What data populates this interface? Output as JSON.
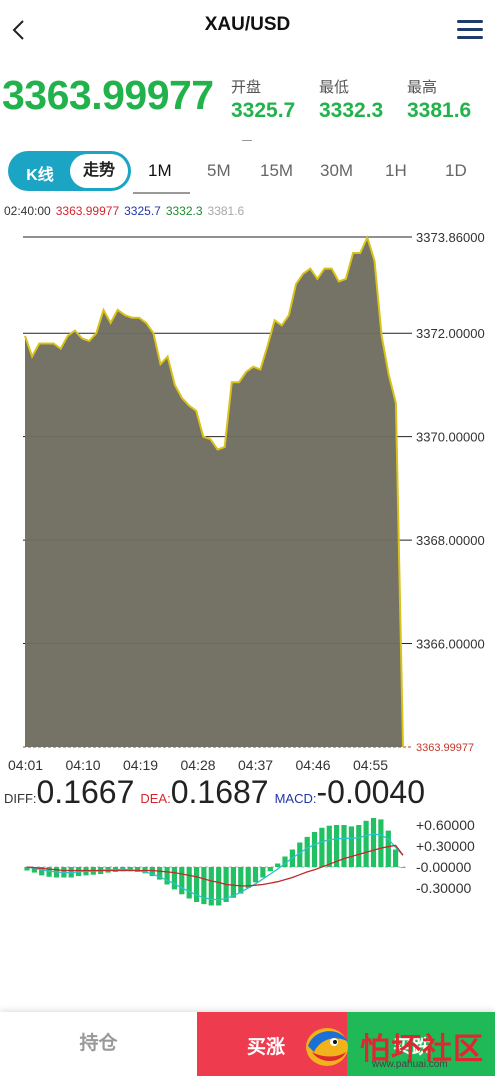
{
  "header": {
    "title": "XAU/USD"
  },
  "quote": {
    "price": "3363.99977",
    "stats": [
      {
        "label": "开盘",
        "value": "3325.7"
      },
      {
        "label": "最低",
        "value": "3332.3"
      },
      {
        "label": "最高",
        "value": "3381.6"
      }
    ]
  },
  "tabs": {
    "kline": "K线",
    "trend": "走势",
    "periods": [
      "1M",
      "5M",
      "15M",
      "30M",
      "1H",
      "1D"
    ],
    "active_period": "1M"
  },
  "info_bar": {
    "time": "02:40:00",
    "price": "3363.99977",
    "open": "3325.7",
    "low": "3332.3",
    "high": "3381.6"
  },
  "colors": {
    "up": "#21b24b",
    "down": "#ee3b4e",
    "accent": "#1ba4c4",
    "line": "#d8c21a",
    "area": "#6f6c60"
  },
  "chart_data": {
    "type": "area",
    "x_ticks": [
      "04:01",
      "04:10",
      "04:19",
      "04:28",
      "04:37",
      "04:46",
      "04:55"
    ],
    "y_ticks": [
      "3373.86000",
      "3372.00000",
      "3370.00000",
      "3368.00000",
      "3366.00000"
    ],
    "last_label": "3363.99977",
    "y_range": [
      3363.99977,
      3373.86
    ],
    "series": [
      {
        "values": [
          3371.95,
          3371.55,
          3371.8,
          3371.8,
          3371.8,
          3371.7,
          3371.95,
          3372.05,
          3371.9,
          3371.85,
          3372.0,
          3372.45,
          3372.2,
          3372.45,
          3372.35,
          3372.3,
          3372.3,
          3372.2,
          3372.0,
          3371.4,
          3371.55,
          3371.0,
          3370.75,
          3370.6,
          3370.5,
          3370.0,
          3369.95,
          3369.75,
          3369.8,
          3371.05,
          3371.05,
          3371.25,
          3371.35,
          3371.3,
          3371.75,
          3372.25,
          3372.15,
          3372.35,
          3372.95,
          3373.15,
          3373.25,
          3373.05,
          3373.25,
          3373.25,
          3373.0,
          3373.05,
          3373.55,
          3373.55,
          3373.85,
          3373.4,
          3371.95,
          3371.2,
          3370.65,
          3364.0
        ]
      }
    ]
  },
  "macd": {
    "diff_label": "DIFF:",
    "diff": "0.1667",
    "dea_label": "DEA:",
    "dea": "0.1687",
    "macd_label": "MACD:",
    "macd": "-0.0040",
    "y_ticks": [
      "+0.60000",
      "+0.30000",
      "-0.00000",
      "-0.30000"
    ],
    "hist": [
      -0.05,
      -0.08,
      -0.12,
      -0.14,
      -0.15,
      -0.15,
      -0.15,
      -0.13,
      -0.12,
      -0.11,
      -0.1,
      -0.08,
      -0.07,
      -0.06,
      -0.06,
      -0.07,
      -0.09,
      -0.13,
      -0.18,
      -0.25,
      -0.32,
      -0.39,
      -0.45,
      -0.5,
      -0.53,
      -0.55,
      -0.55,
      -0.5,
      -0.44,
      -0.38,
      -0.3,
      -0.22,
      -0.15,
      -0.06,
      0.05,
      0.15,
      0.25,
      0.35,
      0.43,
      0.5,
      0.56,
      0.59,
      0.6,
      0.6,
      0.58,
      0.6,
      0.66,
      0.7,
      0.68,
      0.52,
      0.25,
      -0.004
    ],
    "diff_line": [
      0.0,
      -0.02,
      -0.04,
      -0.06,
      -0.07,
      -0.08,
      -0.08,
      -0.07,
      -0.06,
      -0.06,
      -0.05,
      -0.04,
      -0.04,
      -0.03,
      -0.04,
      -0.05,
      -0.07,
      -0.1,
      -0.14,
      -0.19,
      -0.24,
      -0.3,
      -0.35,
      -0.4,
      -0.44,
      -0.46,
      -0.47,
      -0.45,
      -0.41,
      -0.36,
      -0.3,
      -0.24,
      -0.17,
      -0.1,
      -0.03,
      0.05,
      0.13,
      0.2,
      0.27,
      0.32,
      0.36,
      0.39,
      0.4,
      0.41,
      0.41,
      0.42,
      0.45,
      0.47,
      0.46,
      0.4,
      0.28,
      0.1667
    ],
    "dea_line": [
      0.0,
      -0.01,
      -0.02,
      -0.03,
      -0.04,
      -0.05,
      -0.05,
      -0.05,
      -0.05,
      -0.05,
      -0.05,
      -0.05,
      -0.05,
      -0.05,
      -0.05,
      -0.05,
      -0.05,
      -0.05,
      -0.06,
      -0.07,
      -0.08,
      -0.1,
      -0.12,
      -0.14,
      -0.17,
      -0.2,
      -0.22,
      -0.25,
      -0.26,
      -0.27,
      -0.27,
      -0.26,
      -0.25,
      -0.23,
      -0.21,
      -0.18,
      -0.15,
      -0.11,
      -0.07,
      -0.04,
      0.0,
      0.04,
      0.08,
      0.12,
      0.15,
      0.18,
      0.21,
      0.24,
      0.27,
      0.29,
      0.31,
      0.1687
    ]
  },
  "actions": {
    "hold": "持仓",
    "buy_up": "买涨",
    "buy_down": "买跌"
  },
  "watermark": {
    "text": "怕坏社区",
    "url": "www.pahuai.com"
  }
}
